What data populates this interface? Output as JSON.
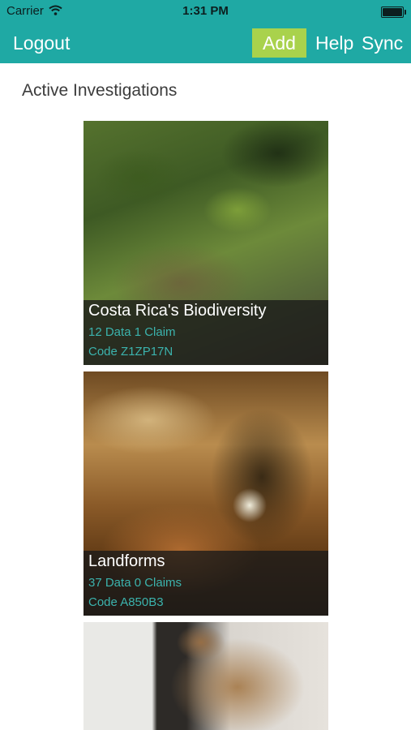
{
  "status_bar": {
    "carrier": "Carrier",
    "wifi_icon": "wifi-icon",
    "time": "1:31 PM",
    "battery_icon": "battery-icon"
  },
  "nav": {
    "logout_label": "Logout",
    "add_label": "Add",
    "help_label": "Help",
    "sync_label": "Sync",
    "accent_color": "#1fa9a4",
    "add_color": "#a9d24c"
  },
  "section_title": "Active Investigations",
  "investigations": [
    {
      "title": "Costa Rica's Biodiversity",
      "stats": "12 Data 1 Claim",
      "code": "Code Z1ZP17N"
    },
    {
      "title": "Landforms",
      "stats": "37 Data 0 Claims",
      "code": "Code A850B3"
    }
  ]
}
